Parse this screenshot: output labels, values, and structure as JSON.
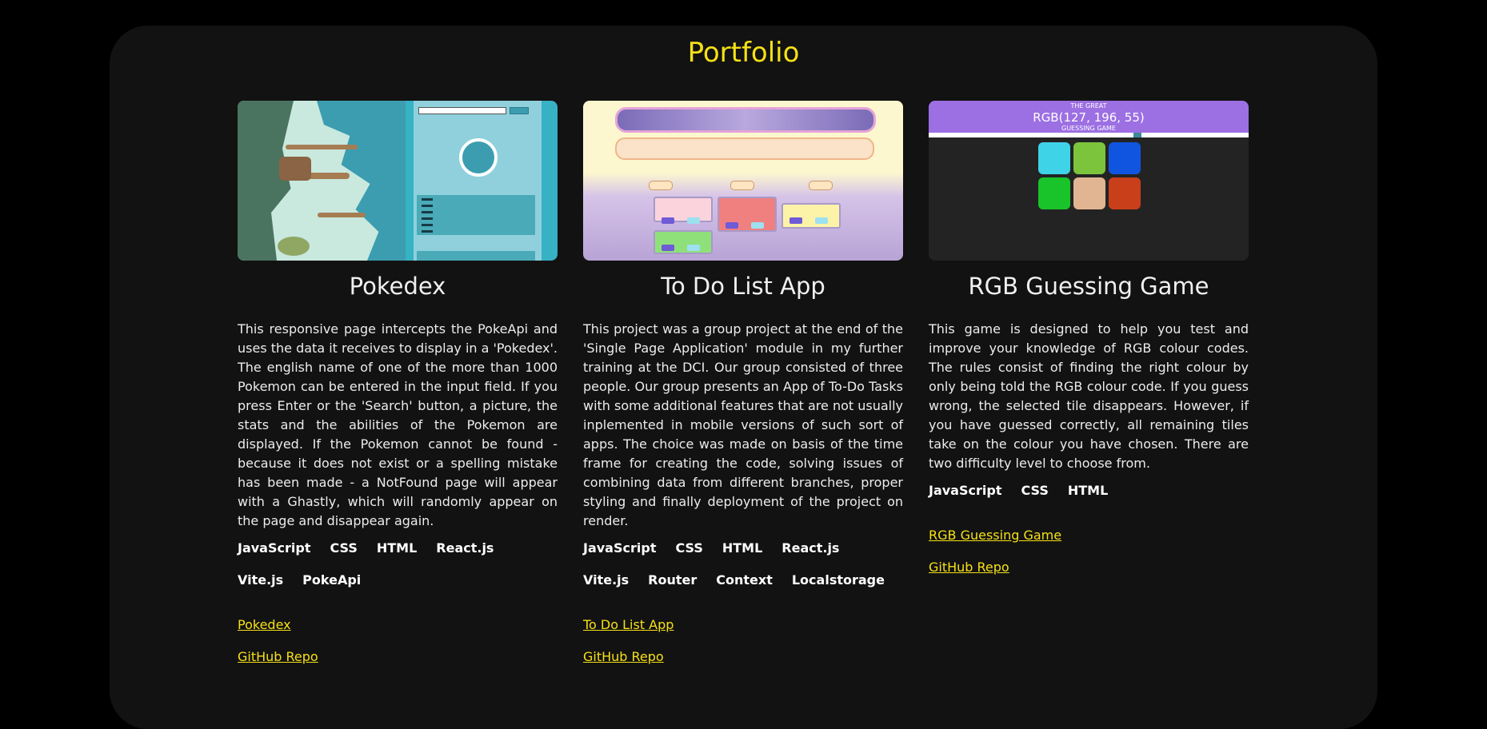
{
  "page": {
    "title": "Portfolio"
  },
  "projects": [
    {
      "title": "Pokedex",
      "description": "This responsive page intercepts the PokeApi and uses the data it receives to display in a 'Pokedex'. The english name of one of the more than 1000 Pokemon can be entered in the input field. If you press Enter or the 'Search' button, a picture, the stats and the abilities of the Pokemon are displayed. If the Pokemon cannot be found - because it does not exist or a spelling mistake has been made - a NotFound page will appear with a Ghastly, which will randomly appear on the page and disappear again.",
      "tags": [
        "JavaScript",
        "CSS",
        "HTML",
        "React.js",
        "Vite.js",
        "PokeApi"
      ],
      "links": [
        "Pokedex",
        "GitHub Repo"
      ]
    },
    {
      "title": "To Do List App",
      "description": "This project was a group project at the end of the 'Single Page Application' module in my further training at the DCI. Our group consisted of three people. Our group presents an App of To-Do Tasks with some additional features that are not usually inplemented in mobile versions of such sort of apps. The choice was made on basis of the time frame for creating the code, solving issues of combining data from different branches, proper styling and finally deployment of the project on render.",
      "tags": [
        "JavaScript",
        "CSS",
        "HTML",
        "React.js",
        "Vite.js",
        "Router",
        "Context",
        "Localstorage"
      ],
      "links": [
        "To Do List App",
        "GitHub Repo"
      ]
    },
    {
      "title": "RGB Guessing Game",
      "description": "This game is designed to help you test and improve your knowledge of RGB colour codes. The rules consist of finding the right colour by only being told the RGB colour code. If you guess wrong, the selected tile disappears. However, if you have guessed correctly, all remaining tiles take on the colour you have chosen. There are two difficulty level to choose from.",
      "tags": [
        "JavaScript",
        "CSS",
        "HTML"
      ],
      "links": [
        "RGB Guessing Game",
        "GitHub Repo"
      ],
      "thumb": {
        "header_small": "THE GREAT",
        "header_rgb": "RGB(127, 196, 55)",
        "header_sub": "GUESSING GAME",
        "tiles": [
          "#3fd3e8",
          "#7cc43c",
          "#0f55e0",
          "#19c42a",
          "#e2b592",
          "#c83f1a"
        ]
      }
    }
  ],
  "colors": {
    "accent": "#f5e016",
    "background": "#000000",
    "panel": "#121212"
  }
}
